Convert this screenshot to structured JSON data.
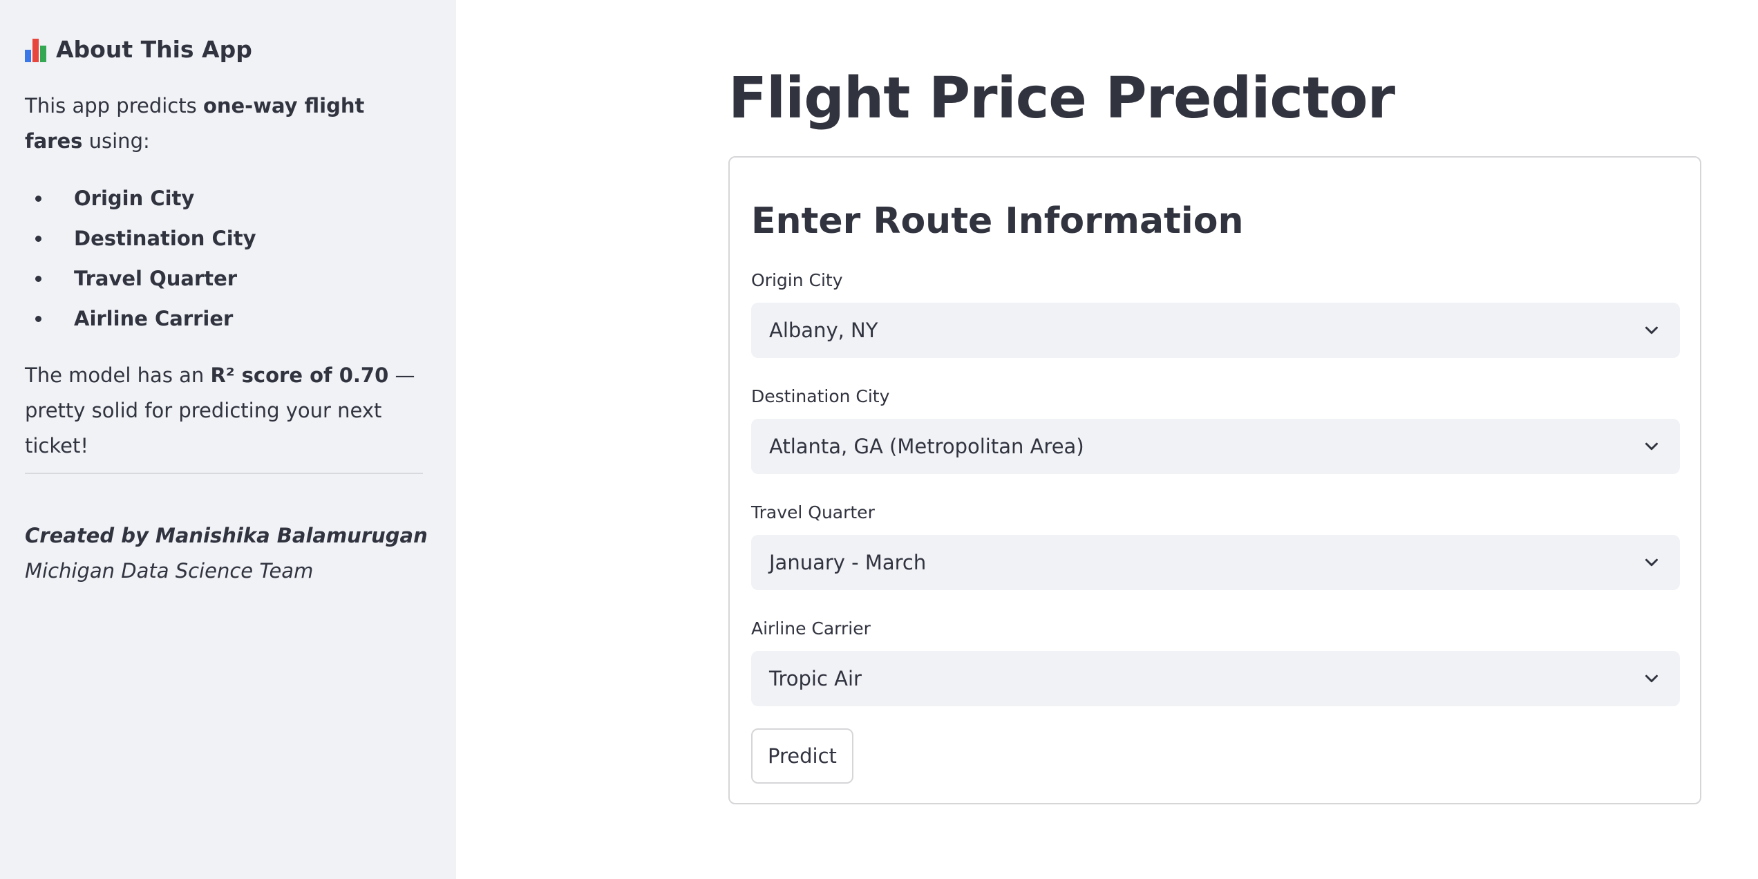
{
  "sidebar": {
    "title": "About This App",
    "title_icon": "bar-chart-icon",
    "intro_prefix": "This app predicts ",
    "intro_bold": "one-way flight fares",
    "intro_suffix": " using:",
    "features": [
      "Origin City",
      "Destination City",
      "Travel Quarter",
      "Airline Carrier"
    ],
    "model_prefix": "The model has an ",
    "model_bold": "R² score of 0.70",
    "model_suffix": " — pretty solid for predicting your next ticket!",
    "credit_line1": "Created by Manishika Balamurugan",
    "credit_line2": "Michigan Data Science Team"
  },
  "main": {
    "title": "Flight Price Predictor",
    "form": {
      "heading": "Enter Route Information",
      "fields": [
        {
          "label": "Origin City",
          "value": "Albany, NY"
        },
        {
          "label": "Destination City",
          "value": "Atlanta, GA (Metropolitan Area)"
        },
        {
          "label": "Travel Quarter",
          "value": "January - March"
        },
        {
          "label": "Airline Carrier",
          "value": "Tropic Air"
        }
      ],
      "submit_label": "Predict"
    }
  },
  "colors": {
    "sidebar_bg": "#f0f2f6",
    "text": "#31333f",
    "select_bg": "#f0f2f6",
    "border": "#d6d6d9"
  }
}
